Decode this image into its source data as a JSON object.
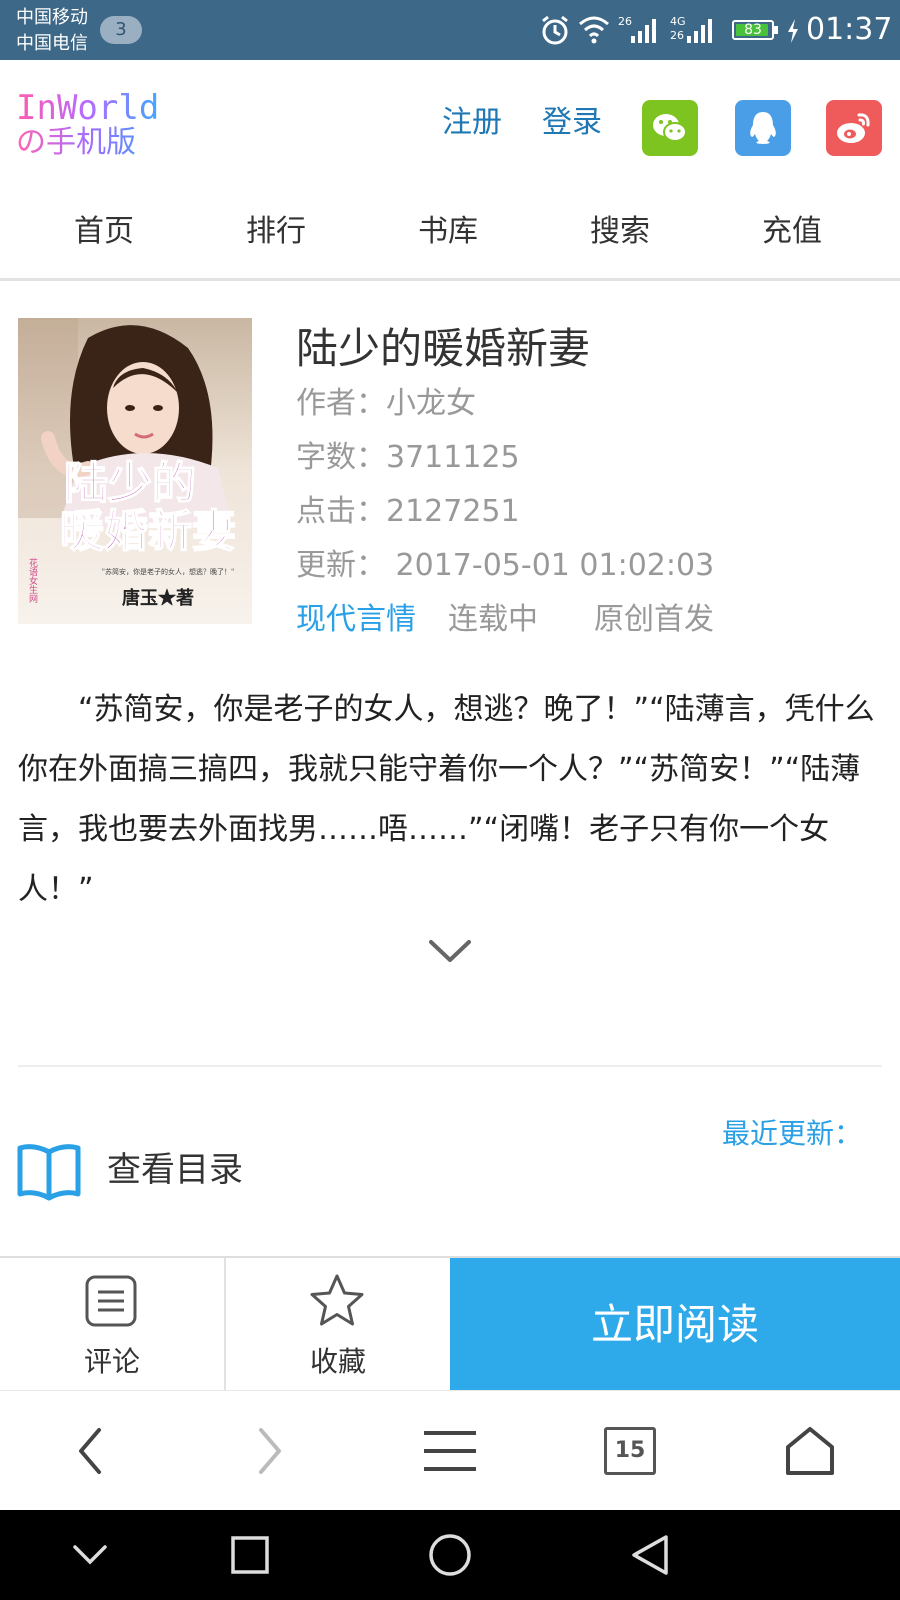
{
  "status_bar": {
    "carrier_1": "中国移动",
    "carrier_2": "中国电信",
    "sim_badge": "3",
    "net_1_top": "26",
    "net_2_top": "4G",
    "net_2_bottom": "26",
    "battery_level": "83",
    "time": "01:37"
  },
  "header": {
    "logo_line1": "InWorld",
    "logo_line2": "の手机版",
    "register": "注册",
    "login": "登录",
    "social_colors": {
      "wechat": "#7ec421",
      "qq": "#4a9ee8",
      "weibo": "#ef5a5a"
    }
  },
  "nav": {
    "items": [
      "首页",
      "排行",
      "书库",
      "搜索",
      "充值"
    ]
  },
  "book": {
    "title": "陆少的暖婚新妻",
    "author_label": "作者：",
    "author": "小龙女",
    "words_label": "字数：",
    "words": "3711125",
    "clicks_label": "点击：",
    "clicks": "2127251",
    "update_label": "更新：",
    "update_time": "2017-05-01 01:02:03",
    "genre": "现代言情",
    "status": "连载中",
    "origin": "原创首发",
    "cover": {
      "title_line1": "陆少的",
      "title_line2": "暖婚新妻",
      "side_text": "花语女生网",
      "blurb": "\"苏简安，你是老子的女人，想逃？晚了！\"",
      "author_sig": "唐玉★著"
    },
    "intro": "“苏简安，你是老子的女人，想逃？晚了！”“陆薄言，凭什么你在外面搞三搞四，我就只能守着你一个人？”“苏简安！”“陆薄言，我也要去外面找男……唔……”“闭嘴！老子只有你一个女人！”"
  },
  "toc": {
    "label": "查看目录",
    "recent_update": "最近更新："
  },
  "actions": {
    "comment": "评论",
    "favorite": "收藏",
    "read_now": "立即阅读"
  },
  "browser": {
    "tab_count": "15"
  },
  "colors": {
    "accent_blue": "#2eaaea",
    "status_bar": "#3d6887",
    "link_blue": "#1f78b4"
  }
}
